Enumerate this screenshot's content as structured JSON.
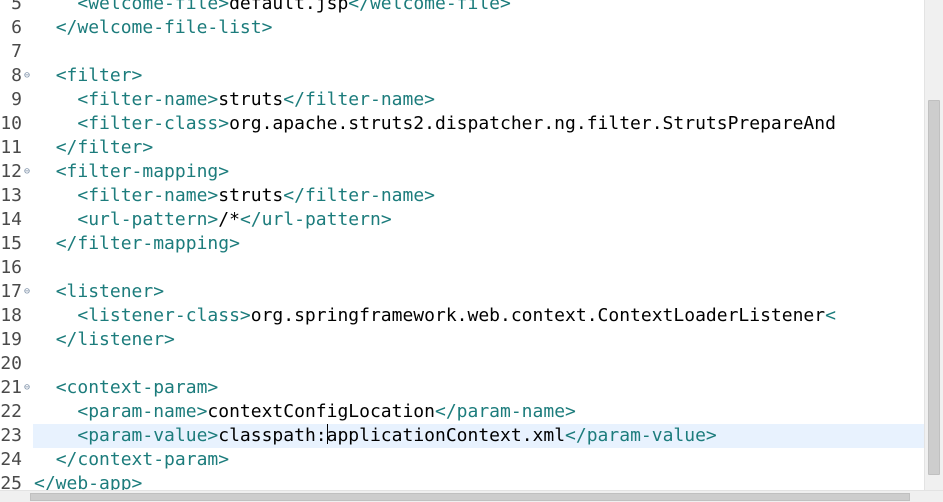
{
  "editor": {
    "current_line": "23",
    "lines": [
      {
        "n": "5",
        "fold": "",
        "indent": "    ",
        "parts": [
          [
            "t",
            "<welcome-file>"
          ],
          [
            "x",
            "default.jsp"
          ],
          [
            "t",
            "</welcome-file>"
          ]
        ]
      },
      {
        "n": "6",
        "fold": "",
        "indent": "  ",
        "parts": [
          [
            "t",
            "</welcome-file-list>"
          ]
        ]
      },
      {
        "n": "7",
        "fold": "",
        "indent": "",
        "parts": []
      },
      {
        "n": "8",
        "fold": "⊖",
        "indent": "  ",
        "parts": [
          [
            "t",
            "<filter>"
          ]
        ]
      },
      {
        "n": "9",
        "fold": "",
        "indent": "    ",
        "parts": [
          [
            "t",
            "<filter-name>"
          ],
          [
            "x",
            "struts"
          ],
          [
            "t",
            "</filter-name>"
          ]
        ]
      },
      {
        "n": "10",
        "fold": "",
        "indent": "    ",
        "parts": [
          [
            "t",
            "<filter-class>"
          ],
          [
            "x",
            "org.apache.struts2.dispatcher.ng.filter.StrutsPrepareAnd"
          ]
        ]
      },
      {
        "n": "11",
        "fold": "",
        "indent": "  ",
        "parts": [
          [
            "t",
            "</filter>"
          ]
        ]
      },
      {
        "n": "12",
        "fold": "⊖",
        "indent": "  ",
        "parts": [
          [
            "t",
            "<filter-mapping>"
          ]
        ]
      },
      {
        "n": "13",
        "fold": "",
        "indent": "    ",
        "parts": [
          [
            "t",
            "<filter-name>"
          ],
          [
            "x",
            "struts"
          ],
          [
            "t",
            "</filter-name>"
          ]
        ]
      },
      {
        "n": "14",
        "fold": "",
        "indent": "    ",
        "parts": [
          [
            "t",
            "<url-pattern>"
          ],
          [
            "x",
            "/*"
          ],
          [
            "t",
            "</url-pattern>"
          ]
        ]
      },
      {
        "n": "15",
        "fold": "",
        "indent": "  ",
        "parts": [
          [
            "t",
            "</filter-mapping>"
          ]
        ]
      },
      {
        "n": "16",
        "fold": "",
        "indent": "",
        "parts": []
      },
      {
        "n": "17",
        "fold": "⊖",
        "indent": "  ",
        "parts": [
          [
            "t",
            "<listener>"
          ]
        ]
      },
      {
        "n": "18",
        "fold": "",
        "indent": "    ",
        "parts": [
          [
            "t",
            "<listener-class>"
          ],
          [
            "x",
            "org.springframework.web.context.ContextLoaderListener"
          ],
          [
            "t",
            "<"
          ]
        ]
      },
      {
        "n": "19",
        "fold": "",
        "indent": "  ",
        "parts": [
          [
            "t",
            "</listener>"
          ]
        ]
      },
      {
        "n": "20",
        "fold": "",
        "indent": "",
        "parts": []
      },
      {
        "n": "21",
        "fold": "⊖",
        "indent": "  ",
        "parts": [
          [
            "t",
            "<context-param>"
          ]
        ]
      },
      {
        "n": "22",
        "fold": "",
        "indent": "    ",
        "parts": [
          [
            "t",
            "<param-name>"
          ],
          [
            "x",
            "contextConfigLocation"
          ],
          [
            "t",
            "</param-name>"
          ]
        ]
      },
      {
        "n": "23",
        "fold": "",
        "indent": "    ",
        "parts": [
          [
            "t",
            "<param-value>"
          ],
          [
            "x",
            "classpath:"
          ],
          [
            "c",
            ""
          ],
          [
            "x",
            "applicationContext.xml"
          ],
          [
            "t",
            "</param-value>"
          ]
        ]
      },
      {
        "n": "24",
        "fold": "",
        "indent": "  ",
        "parts": [
          [
            "t",
            "</context-param>"
          ]
        ]
      },
      {
        "n": "25",
        "fold": "",
        "indent": "",
        "parts": [
          [
            "t",
            "</web-app>"
          ]
        ]
      }
    ]
  }
}
